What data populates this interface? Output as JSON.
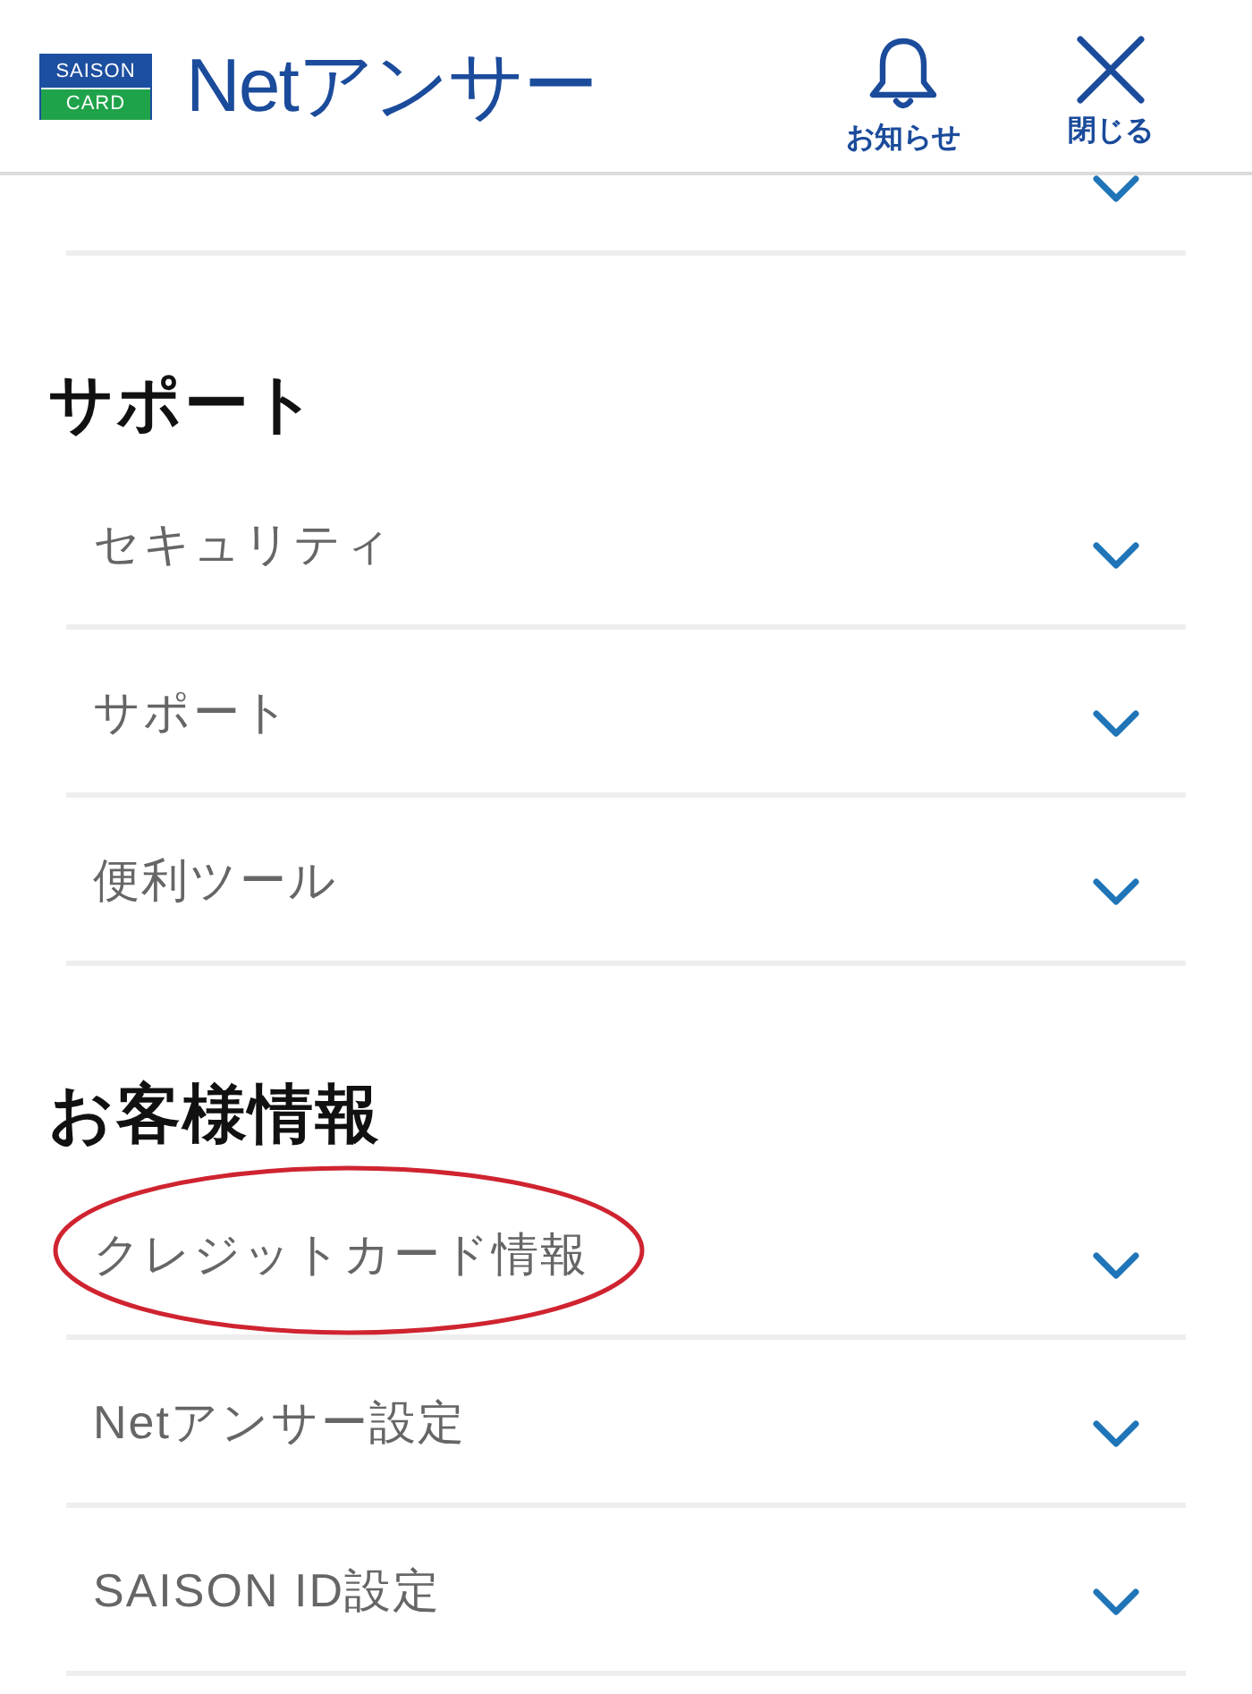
{
  "header": {
    "logo": {
      "top": "SAISON",
      "bottom": "CARD"
    },
    "title": "Netアンサー",
    "actions": [
      {
        "kind": "bell",
        "label": "お知らせ"
      },
      {
        "kind": "close",
        "label": "閉じる"
      }
    ]
  },
  "cut_off_row": {
    "expanded": false
  },
  "sections": [
    {
      "heading": "サポート",
      "items": [
        {
          "label": "セキュリティ",
          "expanded": false,
          "circled": false
        },
        {
          "label": "サポート",
          "expanded": false,
          "circled": false
        },
        {
          "label": "便利ツール",
          "expanded": false,
          "circled": false
        }
      ]
    },
    {
      "heading": "お客様情報",
      "items": [
        {
          "label": "クレジットカード情報",
          "expanded": false,
          "circled": true
        },
        {
          "label": "Netアンサー設定",
          "expanded": false,
          "circled": false
        },
        {
          "label": "SAISON ID設定",
          "expanded": false,
          "circled": false
        }
      ]
    }
  ]
}
